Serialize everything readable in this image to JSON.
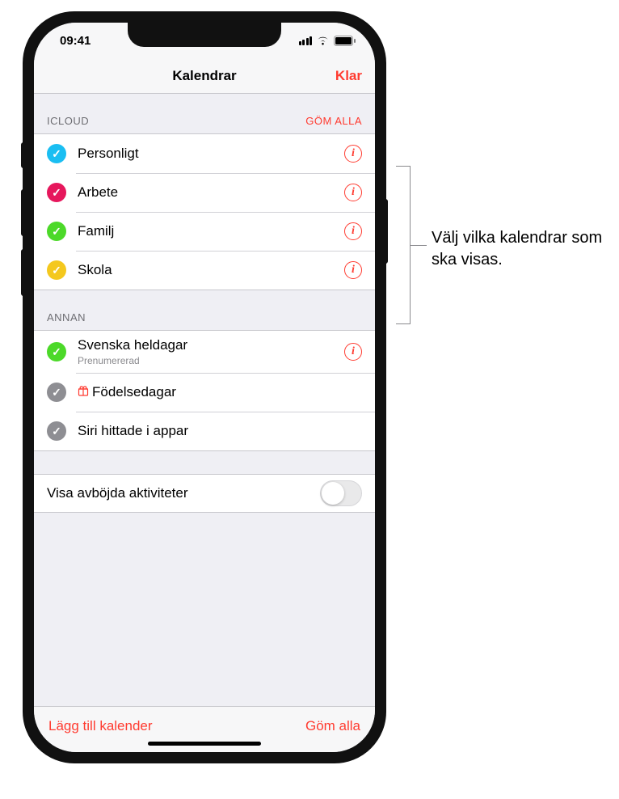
{
  "status": {
    "time": "09:41"
  },
  "nav": {
    "title": "Kalendrar",
    "done": "Klar"
  },
  "sections": {
    "icloud": {
      "header": "ICLOUD",
      "hide_all": "GÖM ALLA",
      "items": [
        {
          "label": "Personligt",
          "color": "#1abef2"
        },
        {
          "label": "Arbete",
          "color": "#e6175c"
        },
        {
          "label": "Familj",
          "color": "#4cd929"
        },
        {
          "label": "Skola",
          "color": "#f4c81e"
        }
      ]
    },
    "other": {
      "header": "ANNAN",
      "items": [
        {
          "label": "Svenska heldagar",
          "sublabel": "Prenumererad",
          "color": "#4cd929",
          "info": true
        },
        {
          "label": "Födelsedagar",
          "color": "#8e8e93",
          "gift": true,
          "info": false
        },
        {
          "label": "Siri hittade i appar",
          "color": "#8e8e93",
          "info": false
        }
      ]
    }
  },
  "toggle": {
    "label": "Visa avböjda aktiviteter",
    "on": false
  },
  "toolbar": {
    "left": "Lägg till kalender",
    "right": "Göm alla"
  },
  "callout": {
    "text": "Välj vilka kalendrar som ska visas."
  }
}
